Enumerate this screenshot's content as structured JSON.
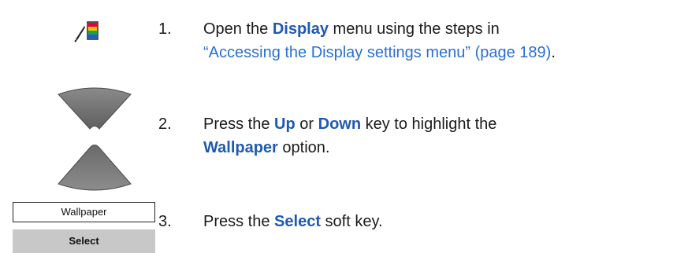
{
  "steps": [
    {
      "number": "1.",
      "line1_pre": "Open the ",
      "line1_kw": "Display",
      "line1_post": " menu using the steps in",
      "line2_link": "“Accessing the Display settings menu” (page 189)",
      "line2_post": "."
    },
    {
      "number": "2.",
      "line1_pre": "Press the ",
      "line1_kw1": "Up",
      "line1_mid": " or ",
      "line1_kw2": "Down",
      "line1_post": " key to highlight the",
      "line2_kw": "Wallpaper",
      "line2_post": " option."
    },
    {
      "number": "3.",
      "line1_pre": "Press the ",
      "line1_kw": "Select",
      "line1_post": " soft key."
    }
  ],
  "softkey": {
    "screen_label": "Wallpaper",
    "button_label": "Select"
  },
  "icons": {
    "display_settings": "display-settings-icon",
    "up_key": "up-key-icon",
    "down_key": "down-key-icon"
  },
  "colors": {
    "keyword": "#1f59b0",
    "link": "#2b6fd1",
    "softkey_bar": "#c8c8c8"
  }
}
